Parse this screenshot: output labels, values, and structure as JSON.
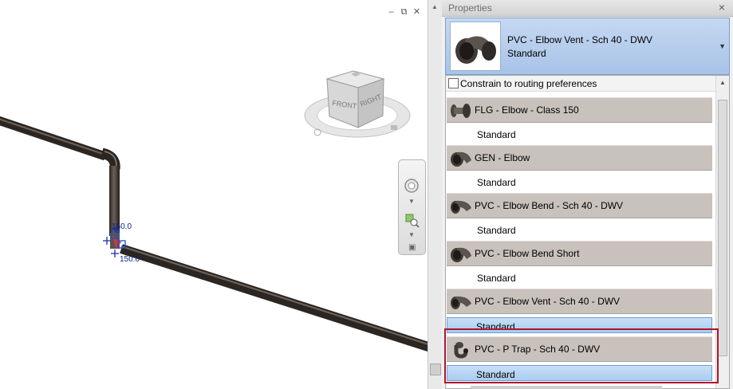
{
  "viewport": {
    "dimensions": [
      "150.0",
      "150.0"
    ],
    "view_cube_faces": [
      "FRONT",
      "RIGHT"
    ],
    "window_controls": [
      "minimize-icon",
      "restore-icon",
      "close-icon"
    ]
  },
  "properties": {
    "title": "Properties",
    "close_glyph": "×",
    "type_selector": {
      "family": "PVC - Elbow Vent - Sch 40 - DWV",
      "type": "Standard",
      "icon": "elbow-fitting-icon"
    },
    "constrain_label": "Constrain to routing preferences",
    "constrain_checked": false,
    "families": [
      {
        "name": "FLG - Elbow - Class 150",
        "icon": "flanged-elbow-icon",
        "types": [
          {
            "name": "Standard",
            "selected": false
          }
        ]
      },
      {
        "name": "GEN - Elbow",
        "icon": "elbow-fitting-icon",
        "types": [
          {
            "name": "Standard",
            "selected": false
          }
        ]
      },
      {
        "name": "PVC - Elbow Bend - Sch 40 - DWV",
        "icon": "elbow-fitting-icon",
        "types": [
          {
            "name": "Standard",
            "selected": false
          }
        ]
      },
      {
        "name": "PVC - Elbow Bend Short",
        "icon": "elbow-fitting-icon",
        "types": [
          {
            "name": "Standard",
            "selected": false
          }
        ]
      },
      {
        "name": "PVC - Elbow Vent - Sch 40 - DWV",
        "icon": "elbow-fitting-icon",
        "types": [
          {
            "name": "Standard",
            "selected": true
          }
        ]
      },
      {
        "name": "PVC - P Trap  - Sch 40 - DWV",
        "icon": "p-trap-icon",
        "types": [
          {
            "name": "Standard",
            "selected": true
          }
        ]
      }
    ]
  },
  "colors": {
    "pipe": "#3a332e",
    "selection_blue": "#a9cdf0",
    "family_row_bg": "#c8c1bc",
    "highlight_box": "#b1142a",
    "dimension_text": "#0a1f8f"
  }
}
